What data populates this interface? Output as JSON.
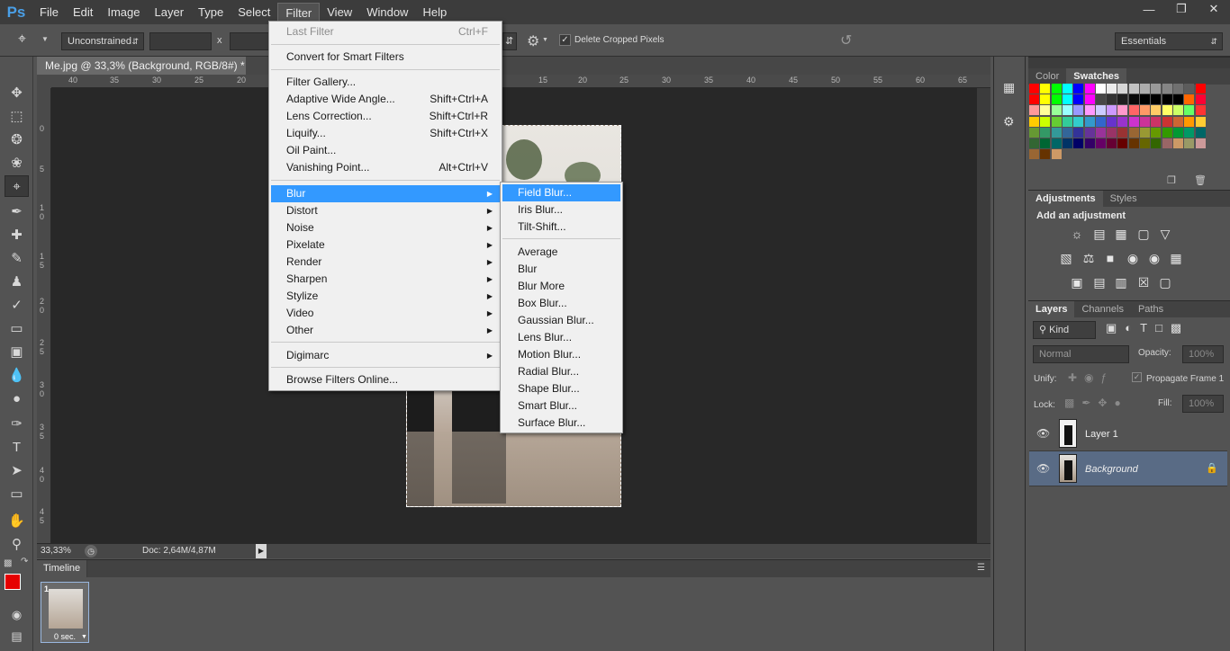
{
  "app": {
    "logo": "Ps",
    "menu": [
      "File",
      "Edit",
      "Image",
      "Layer",
      "Type",
      "Select",
      "Filter",
      "View",
      "Window",
      "Help"
    ],
    "active_menu": "Filter"
  },
  "options_bar": {
    "ratio": "Unconstrained",
    "x_label": "x",
    "delete_cropped": "Delete Cropped Pixels",
    "workspace": "Essentials"
  },
  "document": {
    "tab_title": "Me.jpg @ 33,3% (Background, RGB/8#) *",
    "ruler_top": [
      "40",
      "35",
      "30",
      "25",
      "20",
      "15",
      "20",
      "25",
      "30",
      "35",
      "40",
      "45",
      "50",
      "55",
      "60",
      "65"
    ],
    "ruler_left": [
      "0",
      "5",
      "1 0",
      "1 5",
      "2 0",
      "2 5",
      "3 0",
      "3 5",
      "4 0",
      "4 5",
      "5"
    ],
    "zoom": "33,33%",
    "doc_info": "Doc: 2,64M/4,87M"
  },
  "filter_menu": {
    "last_filter": "Last Filter",
    "last_filter_sc": "Ctrl+F",
    "convert": "Convert for Smart Filters",
    "gallery": "Filter Gallery...",
    "adaptive": "Adaptive Wide Angle...",
    "adaptive_sc": "Shift+Ctrl+A",
    "lens": "Lens Correction...",
    "lens_sc": "Shift+Ctrl+R",
    "liquify": "Liquify...",
    "liquify_sc": "Shift+Ctrl+X",
    "oil": "Oil Paint...",
    "vanishing": "Vanishing Point...",
    "vanishing_sc": "Alt+Ctrl+V",
    "blur": "Blur",
    "distort": "Distort",
    "noise": "Noise",
    "pixelate": "Pixelate",
    "render": "Render",
    "sharpen": "Sharpen",
    "stylize": "Stylize",
    "video": "Video",
    "other": "Other",
    "digimarc": "Digimarc",
    "browse": "Browse Filters Online..."
  },
  "blur_menu": {
    "field": "Field Blur...",
    "iris": "Iris Blur...",
    "tilt": "Tilt-Shift...",
    "average": "Average",
    "blur": "Blur",
    "blur_more": "Blur More",
    "box": "Box Blur...",
    "gaussian": "Gaussian Blur...",
    "lens": "Lens Blur...",
    "motion": "Motion Blur...",
    "radial": "Radial Blur...",
    "shape": "Shape Blur...",
    "smart": "Smart Blur...",
    "surface": "Surface Blur..."
  },
  "panels": {
    "color_tab": "Color",
    "swatches_tab": "Swatches",
    "adjustments_tab": "Adjustments",
    "styles_tab": "Styles",
    "add_adjustment": "Add an adjustment",
    "layers_tab": "Layers",
    "channels_tab": "Channels",
    "paths_tab": "Paths",
    "kind": "Kind",
    "blend_mode": "Normal",
    "opacity_label": "Opacity:",
    "opacity_value": "100%",
    "unify_label": "Unify:",
    "propagate": "Propagate Frame 1",
    "lock_label": "Lock:",
    "fill_label": "Fill:",
    "fill_value": "100%",
    "layers": [
      {
        "name": "Layer 1"
      },
      {
        "name": "Background"
      }
    ]
  },
  "timeline": {
    "tab": "Timeline",
    "frame_number": "1",
    "frame_delay": "0 sec."
  },
  "colors": {
    "foreground": "#e60000",
    "background": "#ffffff",
    "highlight": "#3399ff"
  }
}
